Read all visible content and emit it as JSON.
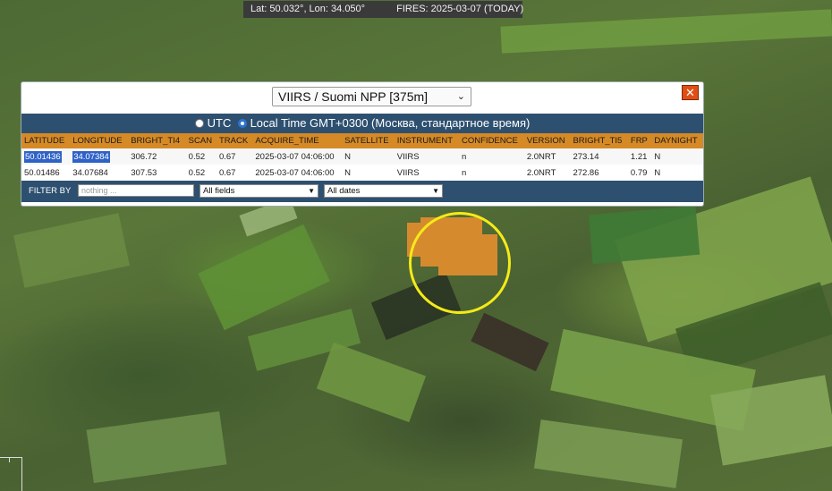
{
  "topbar": {
    "coords": "Lat: 50.032°, Lon: 34.050°",
    "fires": "FIRES: 2025-03-07 (TODAY)"
  },
  "popup": {
    "satellite_select": "VIIRS / Suomi NPP [375m]",
    "close_label": "✕",
    "tz_utc": "UTC",
    "tz_local": "Local Time GMT+0300 (Москва, стандартное время)",
    "columns": [
      "LATITUDE",
      "LONGITUDE",
      "BRIGHT_TI4",
      "SCAN",
      "TRACK",
      "ACQUIRE_TIME",
      "SATELLITE",
      "INSTRUMENT",
      "CONFIDENCE",
      "VERSION",
      "BRIGHT_TI5",
      "FRP",
      "DAYNIGHT"
    ],
    "rows": [
      [
        "50.01436",
        "34.07384",
        "306.72",
        "0.52",
        "0.67",
        "2025-03-07 04:06:00",
        "N",
        "VIIRS",
        "n",
        "2.0NRT",
        "273.14",
        "1.21",
        "N"
      ],
      [
        "50.01486",
        "34.07684",
        "307.53",
        "0.52",
        "0.67",
        "2025-03-07 04:06:00",
        "N",
        "VIIRS",
        "n",
        "2.0NRT",
        "272.86",
        "0.79",
        "N"
      ]
    ],
    "filter": {
      "label": "FILTER BY",
      "placeholder": "nothing ...",
      "fields_select": "All fields",
      "dates_select": "All dates"
    }
  },
  "colors": {
    "header_orange": "#d68a26",
    "bar_blue": "#2e5070",
    "hotspot": "#d68a2e",
    "ring_yellow": "#f5ea18",
    "close_red": "#e04e14"
  }
}
